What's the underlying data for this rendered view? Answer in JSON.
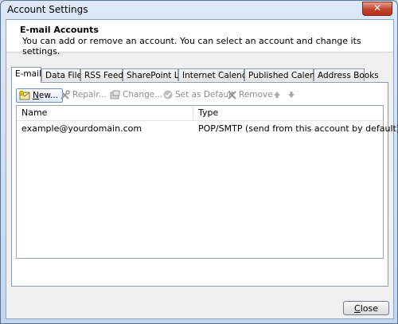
{
  "window": {
    "title": "Account Settings",
    "close_glyph": "✕"
  },
  "header": {
    "title": "E-mail Accounts",
    "description": "You can add or remove an account. You can select an account and change its settings."
  },
  "tabs": [
    {
      "label": "E-mail",
      "active": true
    },
    {
      "label": "Data Files"
    },
    {
      "label": "RSS Feeds"
    },
    {
      "label": "SharePoint Lists"
    },
    {
      "label": "Internet Calendars"
    },
    {
      "label": "Published Calendars"
    },
    {
      "label": "Address Books"
    }
  ],
  "toolbar": {
    "new": {
      "label_u": "N",
      "label_rest": "ew...",
      "enabled": true
    },
    "repair": {
      "label": "Repair...",
      "enabled": false
    },
    "change": {
      "label": "Change...",
      "enabled": false
    },
    "default": {
      "label": "Set as Default",
      "enabled": false
    },
    "remove": {
      "label": "Remove",
      "enabled": false
    }
  },
  "list": {
    "columns": [
      "Name",
      "Type"
    ],
    "rows": [
      {
        "name": "example@yourdomain.com",
        "type": "POP/SMTP (send from this account by default)"
      }
    ]
  },
  "footer": {
    "close_u": "C",
    "close_rest": "lose"
  }
}
